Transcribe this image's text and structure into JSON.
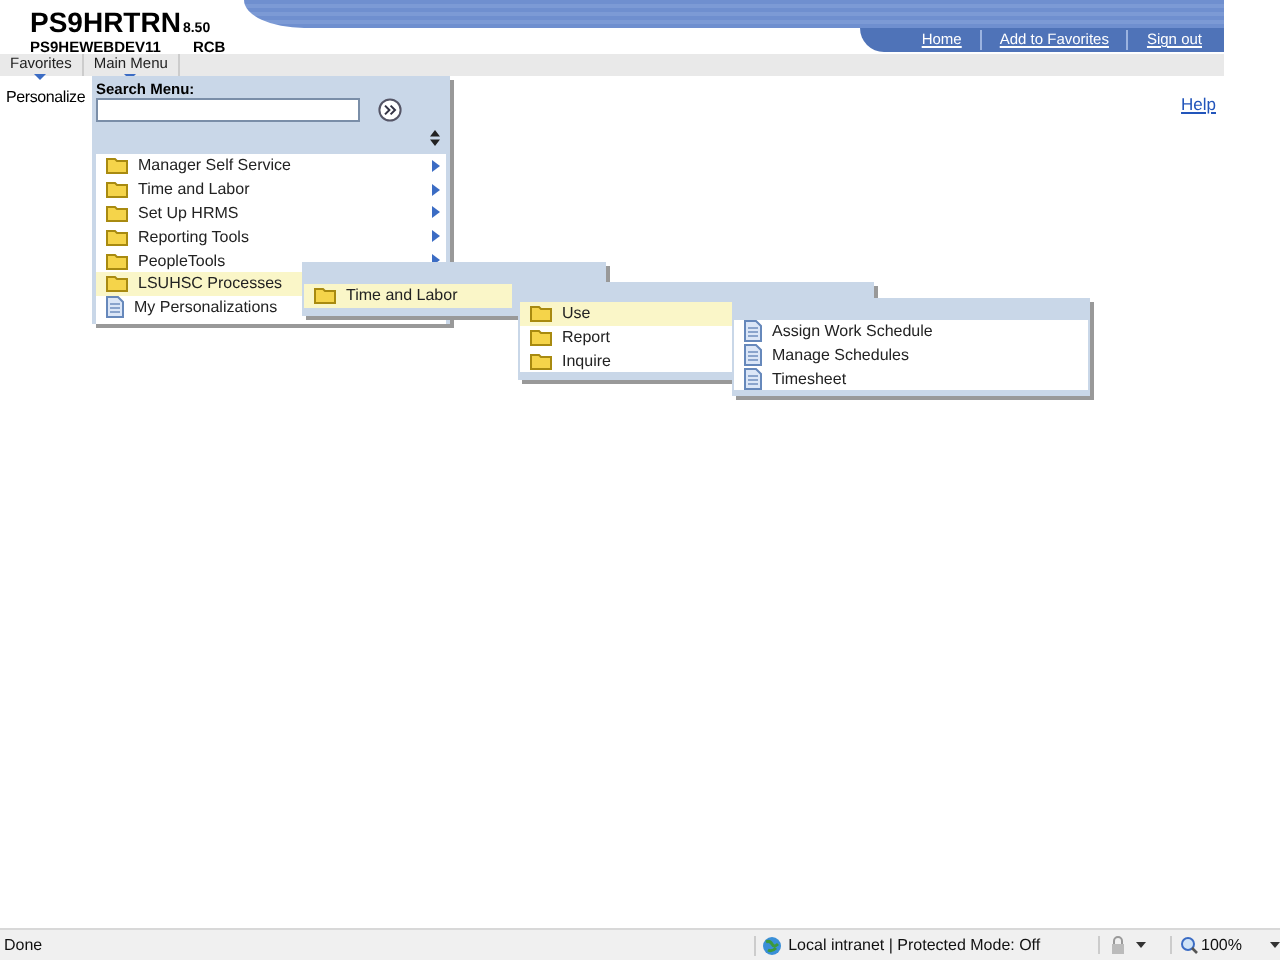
{
  "header": {
    "app_name": "PS9HRTRN",
    "version": "8.50",
    "server": "PS9HEWEBDEV11",
    "user": "RCB",
    "links": [
      "Home",
      "Add to Favorites",
      "Sign out"
    ]
  },
  "menu_bar": [
    "Favorites",
    "Main Menu"
  ],
  "page": {
    "personalize_label": "Personalize",
    "help_link": "Help"
  },
  "main_menu": {
    "search_label": "Search Menu:",
    "items": [
      {
        "label": "Manager Self Service",
        "kind": "folder",
        "has_submenu": true,
        "selected": false
      },
      {
        "label": "Time and Labor",
        "kind": "folder",
        "has_submenu": true,
        "selected": false
      },
      {
        "label": "Set Up HRMS",
        "kind": "folder",
        "has_submenu": true,
        "selected": false
      },
      {
        "label": "Reporting Tools",
        "kind": "folder",
        "has_submenu": true,
        "selected": false
      },
      {
        "label": "PeopleTools",
        "kind": "folder",
        "has_submenu": true,
        "selected": false
      },
      {
        "label": "LSUHSC Processes",
        "kind": "folder",
        "selected": true
      },
      {
        "label": "My Personalizations",
        "kind": "page",
        "selected": false
      }
    ]
  },
  "submenus": [
    {
      "items": [
        {
          "label": "Time and Labor",
          "kind": "folder",
          "selected": true
        }
      ]
    },
    {
      "items": [
        {
          "label": "Use",
          "kind": "folder",
          "selected": true
        },
        {
          "label": "Report",
          "kind": "folder",
          "selected": false
        },
        {
          "label": "Inquire",
          "kind": "folder",
          "selected": false
        }
      ]
    },
    {
      "items": [
        {
          "label": "Assign Work Schedule",
          "kind": "page",
          "selected": false
        },
        {
          "label": "Manage Schedules",
          "kind": "page",
          "selected": false
        },
        {
          "label": "Timesheet",
          "kind": "page",
          "selected": false
        }
      ]
    }
  ],
  "status_bar": {
    "status": "Done",
    "zone": "Local intranet | Protected Mode: Off",
    "zoom": "100%"
  }
}
